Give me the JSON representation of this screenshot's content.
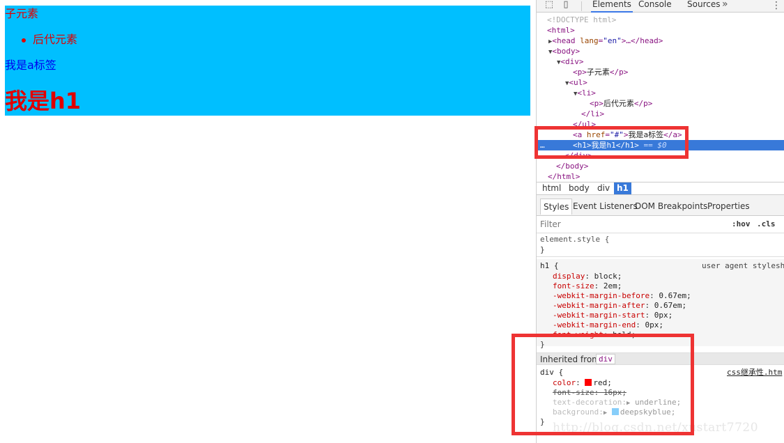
{
  "rendered_page": {
    "p1": "子元素",
    "li_p": "后代元素",
    "a": "我是a标签",
    "h1": "我是h1"
  },
  "devtools": {
    "tabs": [
      "Elements",
      "Console",
      "Sources"
    ],
    "more_label": "»",
    "dom_lines": {
      "doctype": "<!DOCTYPE html>",
      "html_open": "<html>",
      "head_open": "<head",
      "head_attr": "lang",
      "head_val": "\"en\"",
      "head_rest": ">…</head>",
      "body_open": "<body>",
      "div_open": "<div>",
      "p_open": "<p>",
      "p_text": "子元素",
      "p_close": "</p>",
      "ul_open": "<ul>",
      "li_open": "<li>",
      "li_p_text": "后代元素",
      "li_close": "</li>",
      "ul_close": "</ul>",
      "a_open": "<a",
      "a_attr": "href",
      "a_val": "\"#\"",
      "a_text": "我是a标签",
      "a_close": "</a>",
      "h1_open": "<h1>",
      "h1_text": "我是h1",
      "h1_close": "</h1>",
      "dollar": "== $0",
      "dots": "…",
      "div_close": "</div>",
      "body_close": "</body>",
      "html_close": "</html>"
    },
    "breadcrumbs": [
      "html",
      "body",
      "div",
      "h1"
    ],
    "subtabs": [
      "Styles",
      "Event Listeners",
      "DOM Breakpoints",
      "Properties"
    ],
    "filter": {
      "placeholder": "Filter",
      "hov": ":hov",
      "cls": ".cls"
    },
    "styles": {
      "element_style": "element.style {",
      "close_brace": "}",
      "h1_selector": "h1 {",
      "ua_source": "user agent stylesh",
      "h1_props": [
        {
          "name": "display",
          "value": "block;"
        },
        {
          "name": "font-size",
          "value": "2em;"
        },
        {
          "name": "-webkit-margin-before",
          "value": "0.67em;"
        },
        {
          "name": "-webkit-margin-after",
          "value": "0.67em;"
        },
        {
          "name": "-webkit-margin-start",
          "value": "0px;"
        },
        {
          "name": "-webkit-margin-end",
          "value": "0px;"
        },
        {
          "name": "font-weight",
          "value": "bold;"
        }
      ],
      "inherited_label": "Inherited from",
      "inherited_chip": "div",
      "div_selector": "div {",
      "div_source": "css继承性.htm",
      "div_props": {
        "color_name": "color",
        "color_value": "red;",
        "fontsize_text": "font-size: 16px;",
        "textdeco_name": "text-decoration",
        "textdeco_value": "underline;",
        "bg_name": "background",
        "bg_value": "deepskyblue;"
      }
    },
    "watermark": "http://blog.csdn.net/xustart7720"
  },
  "colors": {
    "div_bg": "#00bfff",
    "text_red": "#e00000",
    "link_blue": "#0000ee",
    "selection_blue": "#3879d9",
    "highlight_red": "#ee3333",
    "swatch_red": "#ff0000",
    "swatch_blue": "#87cefa"
  },
  "icons": [
    "inspect-element-icon",
    "device-toolbar-icon",
    "more-tabs-icon",
    "kebab-menu-icon",
    "expand-triangle-icon",
    "collapse-triangle-icon"
  ]
}
